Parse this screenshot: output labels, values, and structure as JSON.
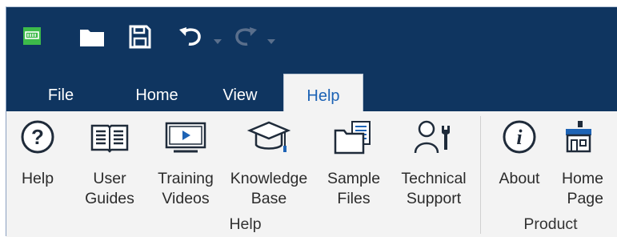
{
  "quick_access": {
    "app_icon": "app-logo-icon",
    "open_icon": "folder-icon",
    "save_icon": "save-icon",
    "undo_icon": "undo-icon",
    "redo_icon": "redo-icon"
  },
  "tabs": [
    {
      "label": "File",
      "active": false
    },
    {
      "label": "Home",
      "active": false
    },
    {
      "label": "View",
      "active": false
    },
    {
      "label": "Help",
      "active": true
    }
  ],
  "ribbon": {
    "groups": [
      {
        "label": "Help",
        "buttons": [
          {
            "line1": "Help",
            "line2": "",
            "icon": "help-circle-icon"
          },
          {
            "line1": "User",
            "line2": "Guides",
            "icon": "book-icon"
          },
          {
            "line1": "Training",
            "line2": "Videos",
            "icon": "video-icon"
          },
          {
            "line1": "Knowledge",
            "line2": "Base",
            "icon": "graduation-cap-icon"
          },
          {
            "line1": "Sample",
            "line2": "Files",
            "icon": "folder-files-icon"
          },
          {
            "line1": "Technical",
            "line2": "Support",
            "icon": "support-person-icon"
          }
        ]
      },
      {
        "label": "Product",
        "buttons": [
          {
            "line1": "About",
            "line2": "",
            "icon": "info-icon"
          },
          {
            "line1": "Home",
            "line2": "Page",
            "icon": "home-page-icon"
          }
        ]
      }
    ]
  },
  "colors": {
    "titlebar": "#0f3560",
    "ribbon": "#f3f3f3",
    "active_tab_text": "#1d63b5",
    "icon_dark": "#1f2b3a",
    "accent_blue": "#1d63b5"
  }
}
